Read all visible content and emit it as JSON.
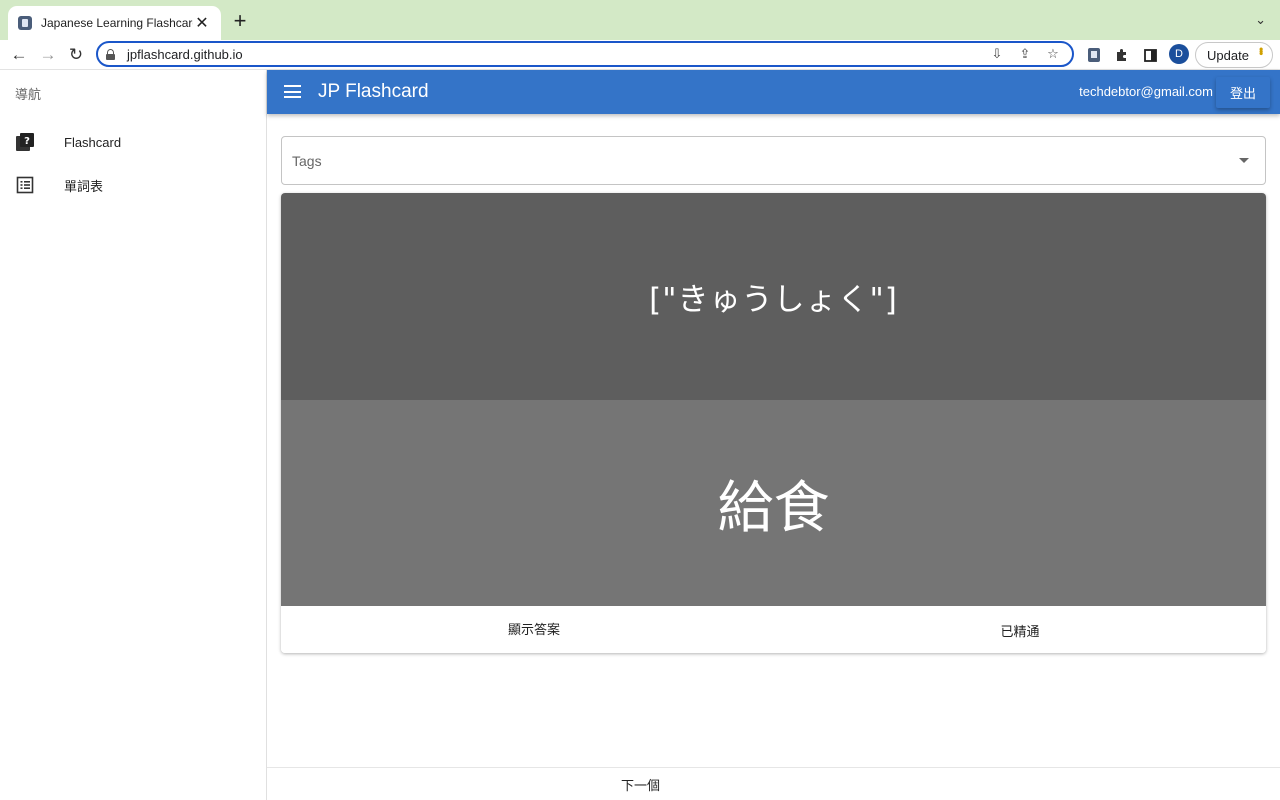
{
  "browser": {
    "tab_title": "Japanese Learning Flashcard",
    "tab_close": "✕",
    "new_tab": "+",
    "url": "jpflashcard.github.io",
    "profile_initial": "D",
    "update_label": "Update"
  },
  "sidebar": {
    "header": "導航",
    "items": [
      {
        "label": "Flashcard",
        "icon": "flashcard-icon"
      },
      {
        "label": "單詞表",
        "icon": "list-icon"
      }
    ]
  },
  "appbar": {
    "title": "JP Flashcard",
    "user_email": "techdebtor@gmail.com",
    "logout_label": "登出",
    "color": "#3474c8"
  },
  "tags": {
    "placeholder": "Tags"
  },
  "card": {
    "reading": "[\"きゅうしょく\"]",
    "kanji": "給食",
    "show_answer_label": "顯示答案",
    "mastered_label": "已精通",
    "reading_bg": "#5e5e5e",
    "kanji_bg": "#757575"
  },
  "footer": {
    "next_label": "下一個"
  }
}
